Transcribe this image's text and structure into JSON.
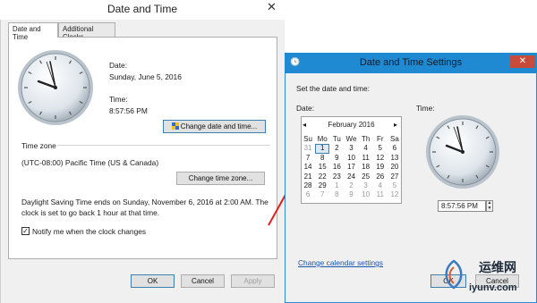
{
  "main_window": {
    "title": "Date and Time",
    "close_glyph": "✕",
    "tabs": [
      "Date and Time",
      "Additional Clocks"
    ],
    "date_label": "Date:",
    "date_value": "Sunday, June 5, 2016",
    "time_label": "Time:",
    "time_value": "8:57:56 PM",
    "change_date_button": "Change date and time...",
    "time_zone_heading": "Time zone",
    "time_zone_value": "(UTC-08:00) Pacific Time (US & Canada)",
    "change_zone_button": "Change time zone...",
    "dst_line1": "Daylight Saving Time ends on Sunday, November 6, 2016 at 2:00 AM. The",
    "dst_line2": "clock is set to go back 1 hour at that time.",
    "notify_label": "Notify me when the clock changes",
    "notify_checked": "✓",
    "ok_button": "OK",
    "cancel_button": "Cancel",
    "apply_button": "Apply"
  },
  "settings_window": {
    "title": "Date and Time Settings",
    "close_glyph": "✕",
    "instruction": "Set the date and time:",
    "date_label": "Date:",
    "time_label": "Time:",
    "month_label": "February 2016",
    "prev_glyph": "◂",
    "next_glyph": "▸",
    "weekdays": [
      "Su",
      "Mo",
      "Tu",
      "We",
      "Th",
      "Fr",
      "Sa"
    ],
    "weeks": [
      [
        "31",
        "1",
        "2",
        "3",
        "4",
        "5",
        "6"
      ],
      [
        "7",
        "8",
        "9",
        "10",
        "11",
        "12",
        "13"
      ],
      [
        "14",
        "15",
        "16",
        "17",
        "18",
        "19",
        "20"
      ],
      [
        "21",
        "22",
        "23",
        "24",
        "25",
        "26",
        "27"
      ],
      [
        "28",
        "29",
        "1",
        "2",
        "3",
        "4",
        "5"
      ],
      [
        "6",
        "7",
        "8",
        "9",
        "10",
        "11",
        "12"
      ]
    ],
    "time_value": "8:57:56 PM",
    "change_calendar_link": "Change calendar settings",
    "ok_button": "OK",
    "cancel_button": "Cancel"
  },
  "watermark": {
    "line1": "运维网",
    "line2": "iyunv.com"
  },
  "colors": {
    "accent": "#1f8ad2",
    "link": "#1a57a8",
    "arrow": "#e02020",
    "close_red": "#c74a3a"
  }
}
